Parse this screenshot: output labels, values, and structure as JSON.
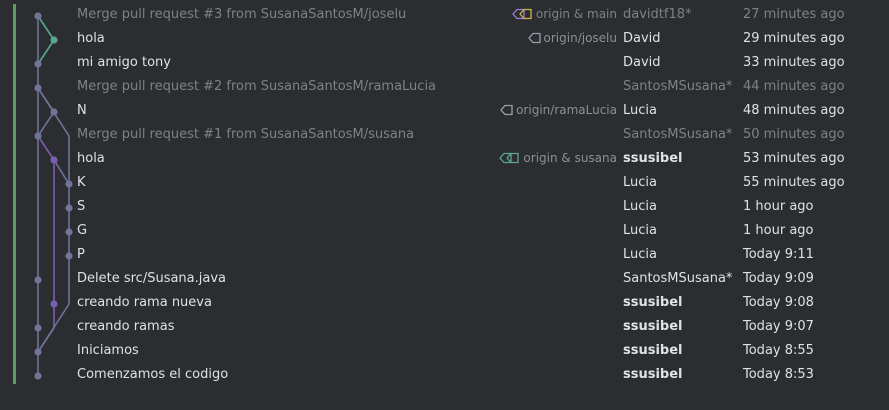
{
  "colors": {
    "background": "#2b2d30",
    "text": "#dfe1e5",
    "dim_text": "#7e8187",
    "accent_bar": "#5a9e64",
    "branch_main": "#6e7596",
    "branch_teal": "#5aa590",
    "branch_purple": "#7a5fb0",
    "tag_outline": "#9aa0aa",
    "tag_yellow": "#c9b84a",
    "tag_purple": "#9d7ed6",
    "tag_green": "#5aa590"
  },
  "commits": [
    {
      "subject": "Merge pull request #3 from SusanaSantosM/joselu",
      "refs": "origin & main",
      "tag_icon": "double-tag-icon",
      "author": "davidtf18*",
      "date": "27 minutes ago",
      "merge": true
    },
    {
      "subject": "hola",
      "refs": "origin/joselu",
      "tag_icon": "tag-icon",
      "author": "David",
      "date": "29 minutes ago",
      "merge": false
    },
    {
      "subject": "mi amigo tony",
      "refs": "",
      "author": "David",
      "date": "33 minutes ago",
      "merge": false
    },
    {
      "subject": "Merge pull request #2 from SusanaSantosM/ramaLucia",
      "refs": "",
      "author": "SantosMSusana*",
      "date": "44 minutes ago",
      "merge": true
    },
    {
      "subject": "N",
      "refs": "origin/ramaLucia",
      "tag_icon": "tag-icon",
      "author": "Lucia",
      "date": "48 minutes ago",
      "merge": false
    },
    {
      "subject": "Merge pull request #1 from SusanaSantosM/susana",
      "refs": "",
      "author": "SantosMSusana*",
      "date": "50 minutes ago",
      "merge": true
    },
    {
      "subject": "hola",
      "refs": "origin & susana",
      "tag_icon": "double-tag-icon",
      "author": "ssusibel",
      "date": "53 minutes ago",
      "merge": false,
      "bold": true
    },
    {
      "subject": "K",
      "refs": "",
      "author": "Lucia",
      "date": "55 minutes ago",
      "merge": false
    },
    {
      "subject": "S",
      "refs": "",
      "author": "Lucia",
      "date": "1 hour ago",
      "merge": false
    },
    {
      "subject": "G",
      "refs": "",
      "author": "Lucia",
      "date": "1 hour ago",
      "merge": false
    },
    {
      "subject": "P",
      "refs": "",
      "author": "Lucia",
      "date": "Today 9:11",
      "merge": false
    },
    {
      "subject": "Delete src/Susana.java",
      "refs": "",
      "author": "SantosMSusana*",
      "date": "Today 9:09",
      "merge": false
    },
    {
      "subject": "creando rama nueva",
      "refs": "",
      "author": "ssusibel",
      "date": "Today 9:08",
      "merge": false,
      "bold": true
    },
    {
      "subject": "creando ramas",
      "refs": "",
      "author": "ssusibel",
      "date": "Today 9:07",
      "merge": false,
      "bold": true
    },
    {
      "subject": "Iniciamos",
      "refs": "",
      "author": "ssusibel",
      "date": "Today 8:55",
      "merge": false,
      "bold": true
    },
    {
      "subject": "Comenzamos el codigo",
      "refs": "",
      "author": "ssusibel",
      "date": "Today 8:53",
      "merge": false,
      "bold": true
    }
  ]
}
